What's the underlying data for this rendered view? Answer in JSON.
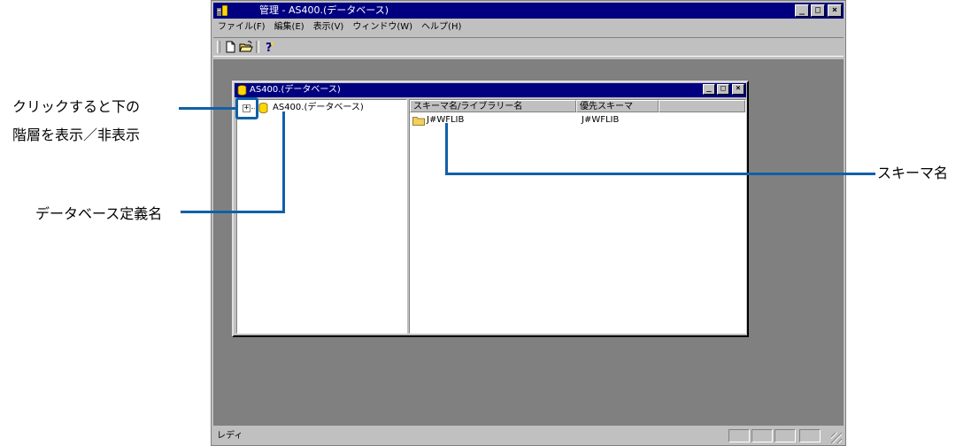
{
  "app": {
    "title": "管理 - AS400.(データベース)",
    "menu": [
      "ファイル(F)",
      "編集(E)",
      "表示(V)",
      "ウィンドウ(W)",
      "ヘルプ(H)"
    ],
    "status": "レディ"
  },
  "child": {
    "title": "AS400.(データベース)",
    "tree": {
      "node_label": "AS400.(データベース)",
      "expander": "+"
    },
    "list": {
      "columns": [
        "スキーマ名/ライブラリー名",
        "優先スキーマ"
      ],
      "rows": [
        {
          "name": "J#WFLIB",
          "preferred": "J#WFLIB"
        }
      ]
    }
  },
  "annotations": {
    "expand_line1": "クリックすると下の",
    "expand_line2": "階層を表示／非表示",
    "db_def_name": "データベース定義名",
    "schema_name": "スキーマ名"
  },
  "colors": {
    "title_bar": "#000080",
    "face": "#c0c0c0",
    "mdi_background": "#808080",
    "callout_blue": "#1060a8",
    "db_icon_yellow": "#ffd700",
    "folder_yellow": "#f0d060"
  }
}
